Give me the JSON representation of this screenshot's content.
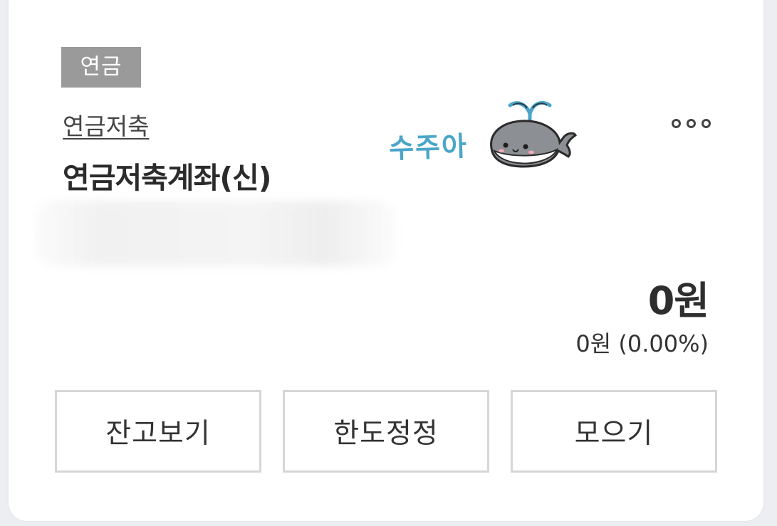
{
  "account": {
    "badge": "연금",
    "product_type": "연금저축",
    "name": "연금저축계좌(신)",
    "balance": "0원",
    "profit": "0원 (0.00%)"
  },
  "sticker": {
    "text": "수주아"
  },
  "actions": {
    "balance_label": "잔고보기",
    "limit_label": "한도정정",
    "save_label": "모으기"
  },
  "colors": {
    "badge_bg": "#9a9a9a",
    "sticker_text": "#4aa6c9",
    "whale_body": "#8c8f94",
    "border": "#d6d6d6"
  },
  "icons": {
    "more": "more-dots-icon",
    "sticker": "whale-icon"
  }
}
